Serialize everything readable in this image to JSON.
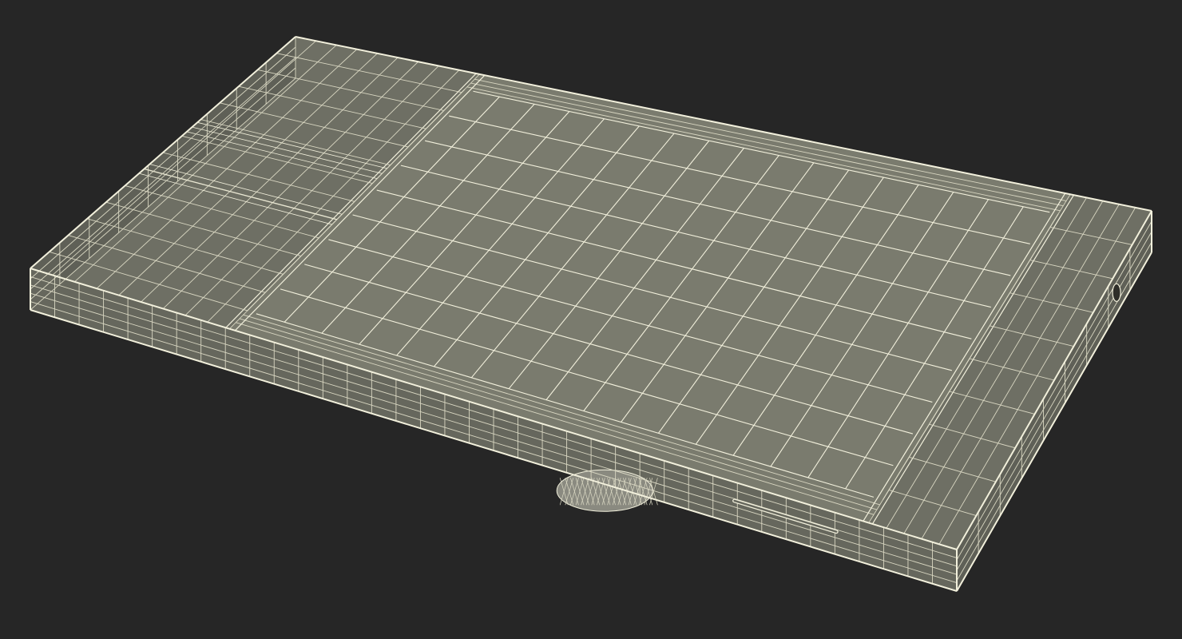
{
  "scene": {
    "subject": "wireframe-device",
    "colors": {
      "background": "#262626",
      "screen_fill": "#7a7b6e",
      "body_top_fill": "#6e6f64",
      "side_fill": "#5f6057",
      "front_fill": "#66675d",
      "wire": "#f2f0dc",
      "wire_dim": "#d9d7c2",
      "dial_fill": "#8a8a80"
    },
    "mesh": {
      "screen_columns": 17,
      "screen_rows": 9,
      "left_section_columns": 9,
      "left_section_rows": 14,
      "right_section_columns": 5,
      "right_section_rows": 10,
      "front_columns": 38,
      "front_rows": 5,
      "side_columns": 9,
      "side_rows": 4
    }
  }
}
